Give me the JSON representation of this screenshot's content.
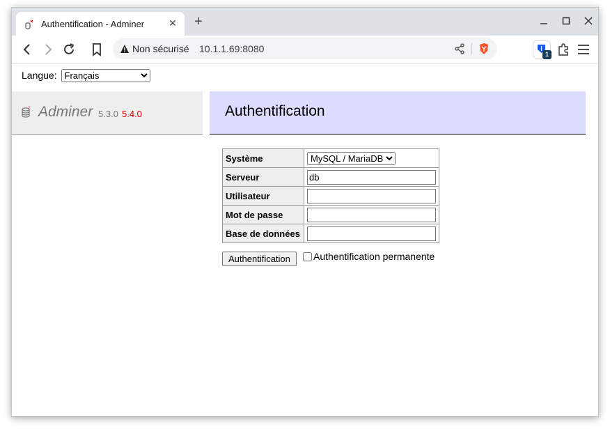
{
  "browser": {
    "tab_title": "Authentification - Adminer",
    "security_label": "Non sécurisé",
    "url": "10.1.1.69:8080",
    "extension_badge": "1"
  },
  "page": {
    "language_label": "Langue:",
    "language_selected": "Français",
    "app_name": "Adminer",
    "version": "5.3.0",
    "new_version": "5.4.0",
    "heading": "Authentification",
    "form": {
      "system_label": "Système",
      "system_selected": "MySQL / MariaDB",
      "server_label": "Serveur",
      "server_value": "db",
      "user_label": "Utilisateur",
      "user_value": "",
      "password_label": "Mot de passe",
      "password_value": "",
      "database_label": "Base de données",
      "database_value": "",
      "submit_label": "Authentification",
      "permanent_label": "Authentification permanente"
    }
  },
  "colors": {
    "header_bg": "#dcdcff",
    "menu_bg": "#eeeeee",
    "new_version": "#e00000"
  }
}
